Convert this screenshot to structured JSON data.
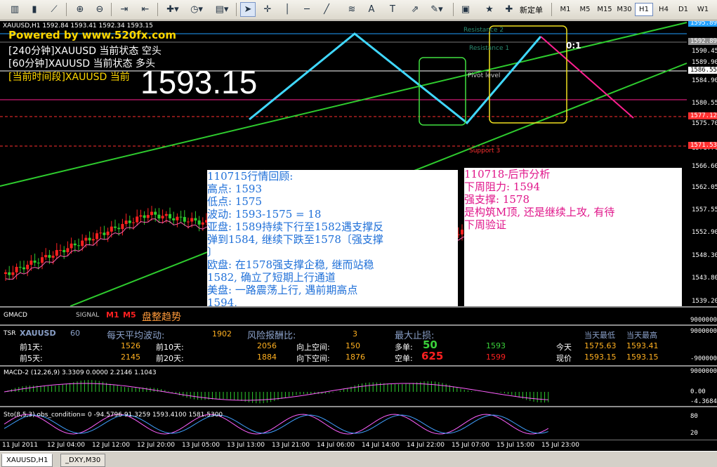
{
  "toolbar": {
    "new_order_label": "新定单",
    "timeframes": [
      "M1",
      "M5",
      "M15",
      "M30",
      "H1",
      "H4",
      "D1",
      "W1"
    ],
    "active_timeframe": "H1"
  },
  "chart": {
    "header": "XAUUSD,H1  1592.84 1593.41 1592.34 1593.15",
    "watermark": "Powered by www.520fx.com",
    "status_lines": [
      "[240分钟]XAUUSD 当前状态 空头",
      "[60分钟]XAUUSD 当前状态 多头",
      "[当前时间段]XAUUSD 当前"
    ],
    "big_price": "1593.15",
    "level_labels": {
      "resistance2": "Resistance 2",
      "resistance1": "Resistance 1",
      "pivot": "Pivot level",
      "support3": "Support 3",
      "marker": "0:1"
    },
    "price_scale": [
      "1590.45",
      "1589.90",
      "1584.90",
      "1580.55",
      "1575.70",
      "1571.70",
      "1566.60",
      "1562.05",
      "1557.55",
      "1552.90",
      "1548.30",
      "1543.80",
      "1539.20"
    ],
    "tagged_prices": [
      {
        "value": "1595.89",
        "color": "#20a0ff"
      },
      {
        "value": "1592.89",
        "color": "#909090"
      },
      {
        "value": "1586.55",
        "color": "#ffffff"
      },
      {
        "value": "1577.12",
        "color": "#ff3030"
      },
      {
        "value": "1571.53",
        "color": "#ff3030"
      }
    ]
  },
  "review_box": {
    "lines": [
      "110715行情回顾:",
      "高点: 1593",
      "低点: 1575",
      "波动: 1593-1575 = 18",
      "亚盘: 1589持续下行至1582遇支撑反",
      "弹到1584, 继续下跌至1578〔强支撑",
      "〕",
      "欧盘: 在1578强支撑企稳, 继而站稳",
      "1582, 确立了短期上行通道",
      "美盘: 一路震荡上行, 遇前期高点",
      "1594,"
    ],
    "color": "#1e6fd8"
  },
  "forecast_box": {
    "lines": [
      "110718-后市分析",
      "下周阻力: 1594",
      "强支撑: 1578",
      "是构筑M顶, 还是继续上攻, 有待",
      "下周验证"
    ],
    "color": "#e0158a"
  },
  "gmacd": {
    "title": "GMACD",
    "signal": "SIGNAL",
    "m1": "M1",
    "m5": "M5",
    "trend": "盘整趋势",
    "scale": "9000000"
  },
  "tsr": {
    "title": "TSR",
    "symbol": "XAUUSD",
    "period": "60",
    "avg_label": "每天平均波动:",
    "avg_value": "1902",
    "risk_label": "风险报酬比:",
    "risk_value": "3",
    "max_stop_label": "最大止损:",
    "today_low_label": "当天最低",
    "today_high_label": "当天最高",
    "d1_label": "前1天:",
    "d1_value": "1526",
    "d10_label": "前10天:",
    "d10_value": "2056",
    "up_label": "向上空间:",
    "up_value": "150",
    "long_label": "多单:",
    "long_stop": "50",
    "long_price": "1593",
    "today_label": "今天",
    "today_low": "1575.63",
    "today_high": "1593.41",
    "d5_label": "前5天:",
    "d5_value": "2145",
    "d20_label": "前20天:",
    "d20_value": "1884",
    "down_label": "向下空间:",
    "down_value": "1876",
    "short_label": "空单:",
    "short_stop": "625",
    "short_price": "1599",
    "now_label": "现价",
    "now_low": "1593.15",
    "now_high": "1593.15",
    "scale_top": "9000000",
    "scale_bottom": "-9000000"
  },
  "macd": {
    "label": "MACD-2 (12,26,9) 3.3309 0.0000 2.2146 1.1043",
    "scale": [
      "9000000",
      "0.00",
      "-4.3684"
    ]
  },
  "stoch": {
    "label": "Sto(8,5,3) obs_condition= 0  -94.5796 91.3259 1593.4100 1581.5300",
    "scale": [
      "80",
      "20"
    ]
  },
  "time_axis": [
    "11 Jul 2011",
    "12 Jul 04:00",
    "12 Jul 12:00",
    "12 Jul 20:00",
    "13 Jul 05:00",
    "13 Jul 13:00",
    "13 Jul 21:00",
    "14 Jul 06:00",
    "14 Jul 14:00",
    "14 Jul 22:00",
    "15 Jul 07:00",
    "15 Jul 15:00",
    "15 Jul 23:00"
  ],
  "tabs": [
    "XAUUSD,H1",
    "_DXY,M30"
  ],
  "active_tab": "XAUUSD,H1"
}
